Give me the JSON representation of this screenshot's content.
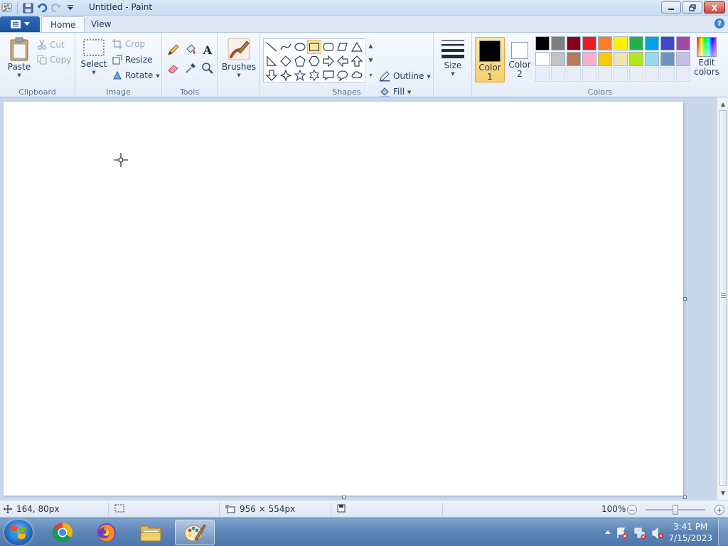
{
  "window": {
    "title": "Untitled - Paint"
  },
  "tabs": {
    "home": "Home",
    "view": "View"
  },
  "ribbon": {
    "clipboard": {
      "label": "Clipboard",
      "paste": "Paste",
      "cut": "Cut",
      "copy": "Copy"
    },
    "image": {
      "label": "Image",
      "select": "Select",
      "crop": "Crop",
      "resize": "Resize",
      "rotate": "Rotate"
    },
    "tools": {
      "label": "Tools"
    },
    "brushes": {
      "label": "Brushes"
    },
    "shapes": {
      "label": "Shapes",
      "outline": "Outline",
      "fill": "Fill"
    },
    "size": {
      "label": "Size"
    },
    "colors": {
      "label": "Colors",
      "color1": "Color",
      "color1_num": "1",
      "color2": "Color",
      "color2_num": "2",
      "edit": "Edit",
      "edit2": "colors",
      "palette_row1": [
        "#000000",
        "#7f7f7f",
        "#880015",
        "#ed1c24",
        "#ff7f27",
        "#fff200",
        "#22b14c",
        "#00a2e8",
        "#3f48cc",
        "#a349a4"
      ],
      "palette_row2": [
        "#ffffff",
        "#c3c3c3",
        "#b97a57",
        "#ffaec9",
        "#ffc90e",
        "#efe4b0",
        "#b5e61d",
        "#99d9ea",
        "#7092be",
        "#c8bfe7"
      ],
      "primary": "#000000",
      "secondary": "#ffffff"
    }
  },
  "status": {
    "cursor_pos": "164, 80px",
    "canvas_size": "956 × 554px",
    "zoom": "100%",
    "zoom_level": 0.5
  },
  "taskbar": {
    "time": "3:41 PM",
    "date": "7/15/2023"
  }
}
